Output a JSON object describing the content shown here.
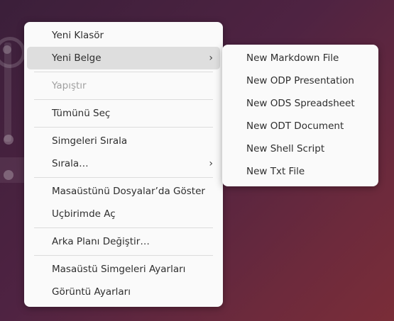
{
  "main_menu": {
    "items": [
      {
        "label": "Yeni Klasör"
      },
      {
        "label": "Yeni Belge",
        "submenu_icon": "chevron-right-icon"
      },
      {
        "label": "Yapıştır",
        "disabled": true
      },
      {
        "label": "Tümünü Seç"
      },
      {
        "label": "Simgeleri Sırala"
      },
      {
        "label": "Sırala…",
        "submenu_icon": "chevron-right-icon"
      },
      {
        "label": "Masaüstünü Dosyalar’da Göster"
      },
      {
        "label": "Uçbirimde Aç"
      },
      {
        "label": "Arka Planı Değiştir…"
      },
      {
        "label": "Masaüstü Simgeleri Ayarları"
      },
      {
        "label": "Görüntü Ayarları"
      }
    ],
    "chevron": "›"
  },
  "sub_menu": {
    "items": [
      {
        "label": "New Markdown File"
      },
      {
        "label": "New ODP Presentation"
      },
      {
        "label": "New ODS Spreadsheet"
      },
      {
        "label": "New ODT Document"
      },
      {
        "label": "New Shell Script"
      },
      {
        "label": "New Txt File"
      }
    ]
  },
  "colors": {
    "menu_bg": "#fafafa",
    "hover_bg": "#dedede",
    "text": "#2e2e2e",
    "disabled_text": "#a0a0a0"
  }
}
